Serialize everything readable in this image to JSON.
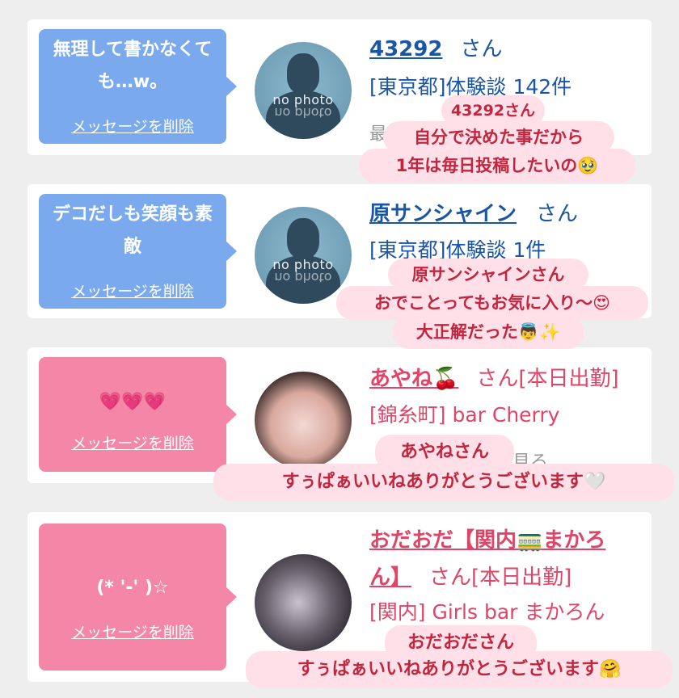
{
  "entries": [
    {
      "message": "無理して書かなくても…w。",
      "delete_label": "メッセージを削除",
      "avatar_text": "no photo",
      "name": "43292",
      "suffix": "さん",
      "info": "[東京都]体験談 142件",
      "faded": "最",
      "theme": "#7aa9ee"
    },
    {
      "message": "デコだしも笑顔も素敵",
      "delete_label": "メッセージを削除",
      "avatar_text": "no photo",
      "name": "原サンシャイン",
      "suffix": "さん",
      "info": "[東京都]体験談 1件",
      "theme": "#7aa9ee"
    },
    {
      "message": "💗💗💗",
      "delete_label": "メッセージを削除",
      "name": "あやね🍒",
      "suffix": "さん[本日出勤]",
      "info": "[錦糸町] bar Cherry",
      "faded": "見る",
      "theme": "#f487a7"
    },
    {
      "message": "(* '-' )☆",
      "delete_label": "メッセージを削除",
      "name_line1": "おだおだ【関内🚃まかろ",
      "name_line2": "ん】",
      "suffix": "さん[本日出勤]",
      "info": "[関内] Girls bar まかろん",
      "theme": "#f487a7"
    }
  ],
  "overlays": [
    {
      "lines": [
        "43292さん",
        "自分で決めた事だから",
        "1年は毎日投稿したいの🥹"
      ]
    },
    {
      "lines": [
        "原サンシャインさん",
        "おでことってもお気に入り〜😍",
        "大正解だった👼✨"
      ]
    },
    {
      "lines": [
        "あやねさん",
        "すぅぱぁいいねありがとうございます🤍"
      ]
    },
    {
      "lines": [
        "おだおださん",
        "すぅぱぁいいねありがとうございます🤗"
      ]
    }
  ]
}
